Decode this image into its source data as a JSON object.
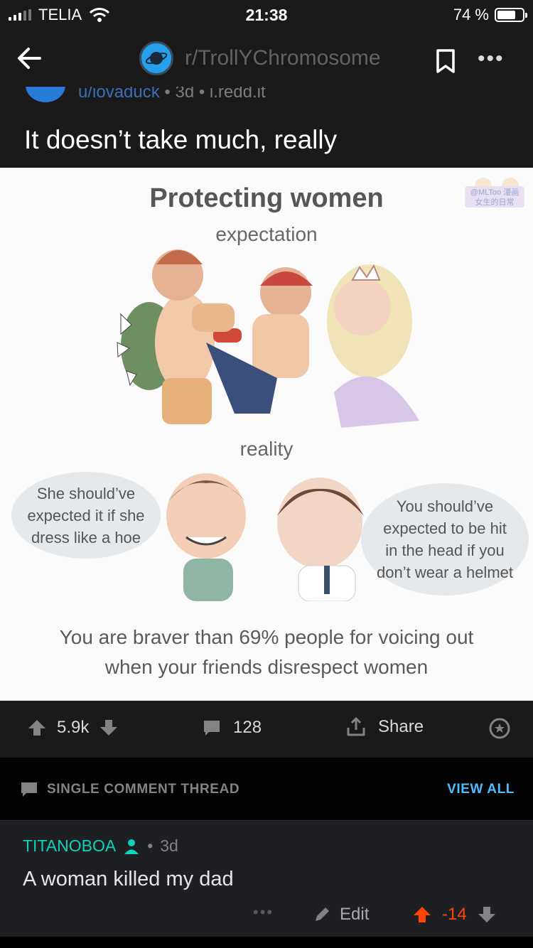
{
  "status_bar": {
    "carrier": "TELIA",
    "time": "21:38",
    "battery_text": "74 %",
    "battery_level": 0.74
  },
  "nav": {
    "subreddit": "r/TrollYChromosome"
  },
  "post": {
    "author": "u/iovaduck",
    "meta_rest": " • 3d • i.redd.it",
    "title": "It doesn’t take much, really"
  },
  "meme": {
    "heading": "Protecting women",
    "expectation": "expectation",
    "reality": "reality",
    "bubble_left": [
      "She should’ve",
      "expected it if she",
      "dress like a hoe"
    ],
    "bubble_right": [
      "You should’ve",
      "expected to be hit",
      "in the head if you",
      "don’t wear a helmet"
    ],
    "bottom_line1": "You are braver than 69% people for voicing out",
    "bottom_line2": "when your friends disrespect women"
  },
  "actions": {
    "score": "5.9k",
    "comments": "128",
    "share": "Share"
  },
  "thread": {
    "label": "SINGLE COMMENT THREAD",
    "view_all": "VIEW ALL"
  },
  "comment": {
    "user": "TITANOBOA",
    "age": "3d",
    "text": "A woman killed my dad",
    "edit": "Edit",
    "score": "-14"
  },
  "colors": {
    "accent": "#24a0ed",
    "link": "#4fbcff",
    "upvote": "#ff4500",
    "username": "#0dd3bb"
  }
}
